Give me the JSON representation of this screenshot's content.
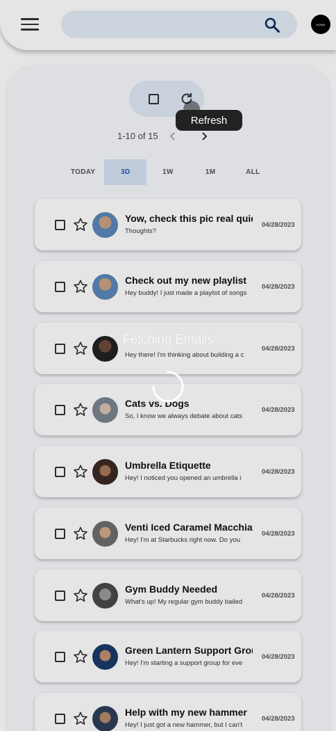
{
  "header": {
    "search_placeholder": "",
    "avatar_text": "ADMIN",
    "icons": {
      "menu": "menu-icon",
      "search": "search-icon"
    }
  },
  "toolbar": {
    "refresh_tooltip": "Refresh"
  },
  "pager": {
    "text": "1-10 of 15"
  },
  "filters": [
    {
      "label": "TODAY",
      "active": false
    },
    {
      "label": "3D",
      "active": true
    },
    {
      "label": "1W",
      "active": false
    },
    {
      "label": "1M",
      "active": false
    },
    {
      "label": "ALL",
      "active": false
    }
  ],
  "emails": [
    {
      "subject": "Yow, check this pic real quick",
      "preview": "Thoughts?",
      "date": "04/28/2023"
    },
    {
      "subject": "Check out my new playlist",
      "preview": "Hey buddy! I just made a playlist of songs",
      "date": "04/28/2023"
    },
    {
      "subject": "",
      "preview": "Hey there! I'm thinking about building a c",
      "date": "04/28/2023"
    },
    {
      "subject": "Cats vs. Dogs",
      "preview": "So, I know we always debate about cats",
      "date": "04/28/2023"
    },
    {
      "subject": "Umbrella Etiquette",
      "preview": "Hey! I noticed you opened an umbrella i",
      "date": "04/28/2023"
    },
    {
      "subject": "Venti Iced Caramel Macchiato",
      "preview": "Hey! I'm at Starbucks right now. Do you",
      "date": "04/28/2023"
    },
    {
      "subject": "Gym Buddy Needed",
      "preview": "What's up! My regular gym buddy bailed",
      "date": "04/28/2023"
    },
    {
      "subject": "Green Lantern Support Group",
      "preview": "Hey! I'm starting a support group for eve",
      "date": "04/28/2023"
    },
    {
      "subject": "Help with my new hammer",
      "preview": "Hey! I just got a new hammer, but I can't",
      "date": "04/28/2023"
    }
  ],
  "loading": {
    "text": "Fetching Emails"
  },
  "colors": {
    "accent": "#1f5fa8",
    "search_bg": "#e3ecf7",
    "toolbar_bg": "#e0e9f6",
    "active_filter_bg": "#d6e4f4"
  }
}
